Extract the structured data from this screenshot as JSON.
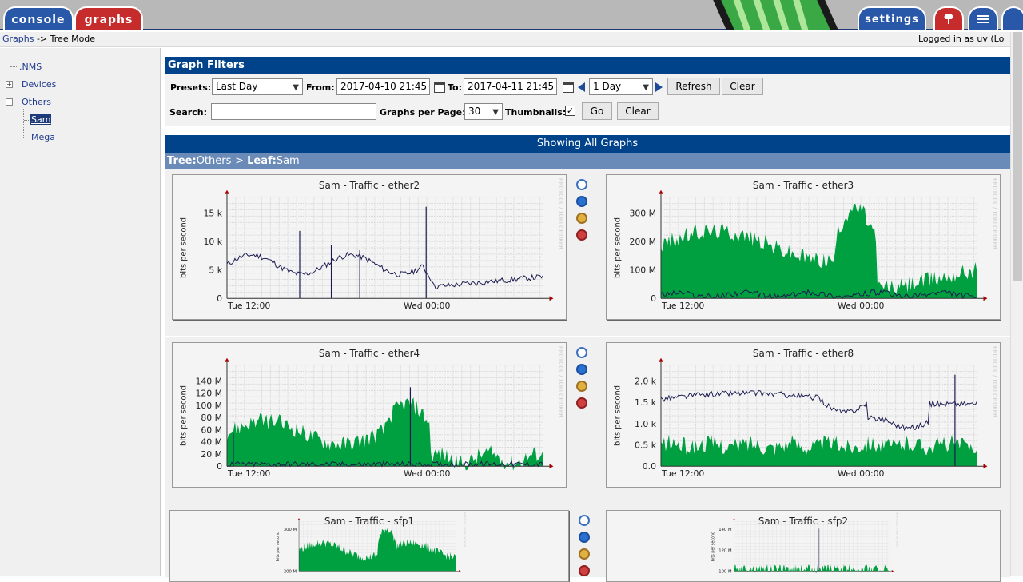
{
  "topnav": {
    "console": "console",
    "graphs": "graphs",
    "settings": "settings"
  },
  "breadcrumb": {
    "graphs": "Graphs",
    "sep": "->",
    "mode": "Tree Mode"
  },
  "login": "Logged in as uv (Lo",
  "tree": {
    "nms": ".NMS",
    "devices": "Devices",
    "others": "Others",
    "sam": "Sam",
    "mega": "Mega"
  },
  "filters": {
    "header": "Graph Filters",
    "presets_label": "Presets:",
    "presets_value": "Last Day",
    "from_label": "From:",
    "from_value": "2017-04-10 21:45",
    "to_label": "To:",
    "to_value": "2017-04-11 21:45",
    "span_value": "1 Day",
    "refresh": "Refresh",
    "clear1": "Clear",
    "search_label": "Search:",
    "search_value": "",
    "per_page_label": "Graphs per Page:",
    "per_page_value": "30",
    "thumbnails_label": "Thumbnails:",
    "thumbnails_checked": true,
    "go": "Go",
    "clear2": "Clear"
  },
  "showing": "Showing All Graphs",
  "tree_path": {
    "tree": "Tree:",
    "tree_value": "Others->",
    "leaf": "Leaf:",
    "leaf_value": "Sam"
  },
  "graphs": [
    {
      "title": "Sam - Traffic - ether2",
      "ylabel": "bits per second",
      "yticks": [
        "15 k",
        "10 k",
        "5 k",
        "0"
      ],
      "xticks": [
        "Tue 12:00",
        "Wed 00:00"
      ],
      "watermark": "RRDTOOL / TOBI OETIKER"
    },
    {
      "title": "Sam - Traffic - ether3",
      "ylabel": "bits per second",
      "yticks": [
        "300 M",
        "200 M",
        "100 M",
        "0"
      ],
      "xticks": [
        "Tue 12:00",
        "Wed 00:00"
      ],
      "watermark": "RRDTOOL / TOBI OETIKER"
    },
    {
      "title": "Sam - Traffic - ether4",
      "ylabel": "bits per second",
      "yticks": [
        "140 M",
        "120 M",
        "100 M",
        "80 M",
        "60 M",
        "40 M",
        "20 M",
        "0"
      ],
      "xticks": [
        "Tue 12:00",
        "Wed 00:00"
      ],
      "watermark": "RRDTOOL / TOBI OETIKER"
    },
    {
      "title": "Sam - Traffic - ether8",
      "ylabel": "bits per second",
      "yticks": [
        "2.0 k",
        "1.5 k",
        "1.0 k",
        "0.5 k",
        "0.0"
      ],
      "xticks": [
        "Tue 12:00",
        "Wed 00:00"
      ],
      "watermark": "RRDTOOL / TOBI OETIKER"
    },
    {
      "title": "Sam - Traffic - sfp1",
      "ylabel": "bits per second",
      "yticks": [
        "300 M",
        "200 M"
      ],
      "xticks": [],
      "watermark": "RRDTOOL / TOBI OETIKER"
    },
    {
      "title": "Sam - Traffic - sfp2",
      "ylabel": "bits per second",
      "yticks": [
        "140 M",
        "120 M",
        "100 M"
      ],
      "xticks": [],
      "watermark": "RRDTOOL / TOBI OETIKER"
    }
  ],
  "colors": {
    "nav": "#00438a",
    "tree_path_bg": "#6a8ab8",
    "inbound": "#00a040",
    "outbound": "#1a1a50",
    "tab_blue": "#2a58a8",
    "tab_red": "#c62c2c"
  }
}
